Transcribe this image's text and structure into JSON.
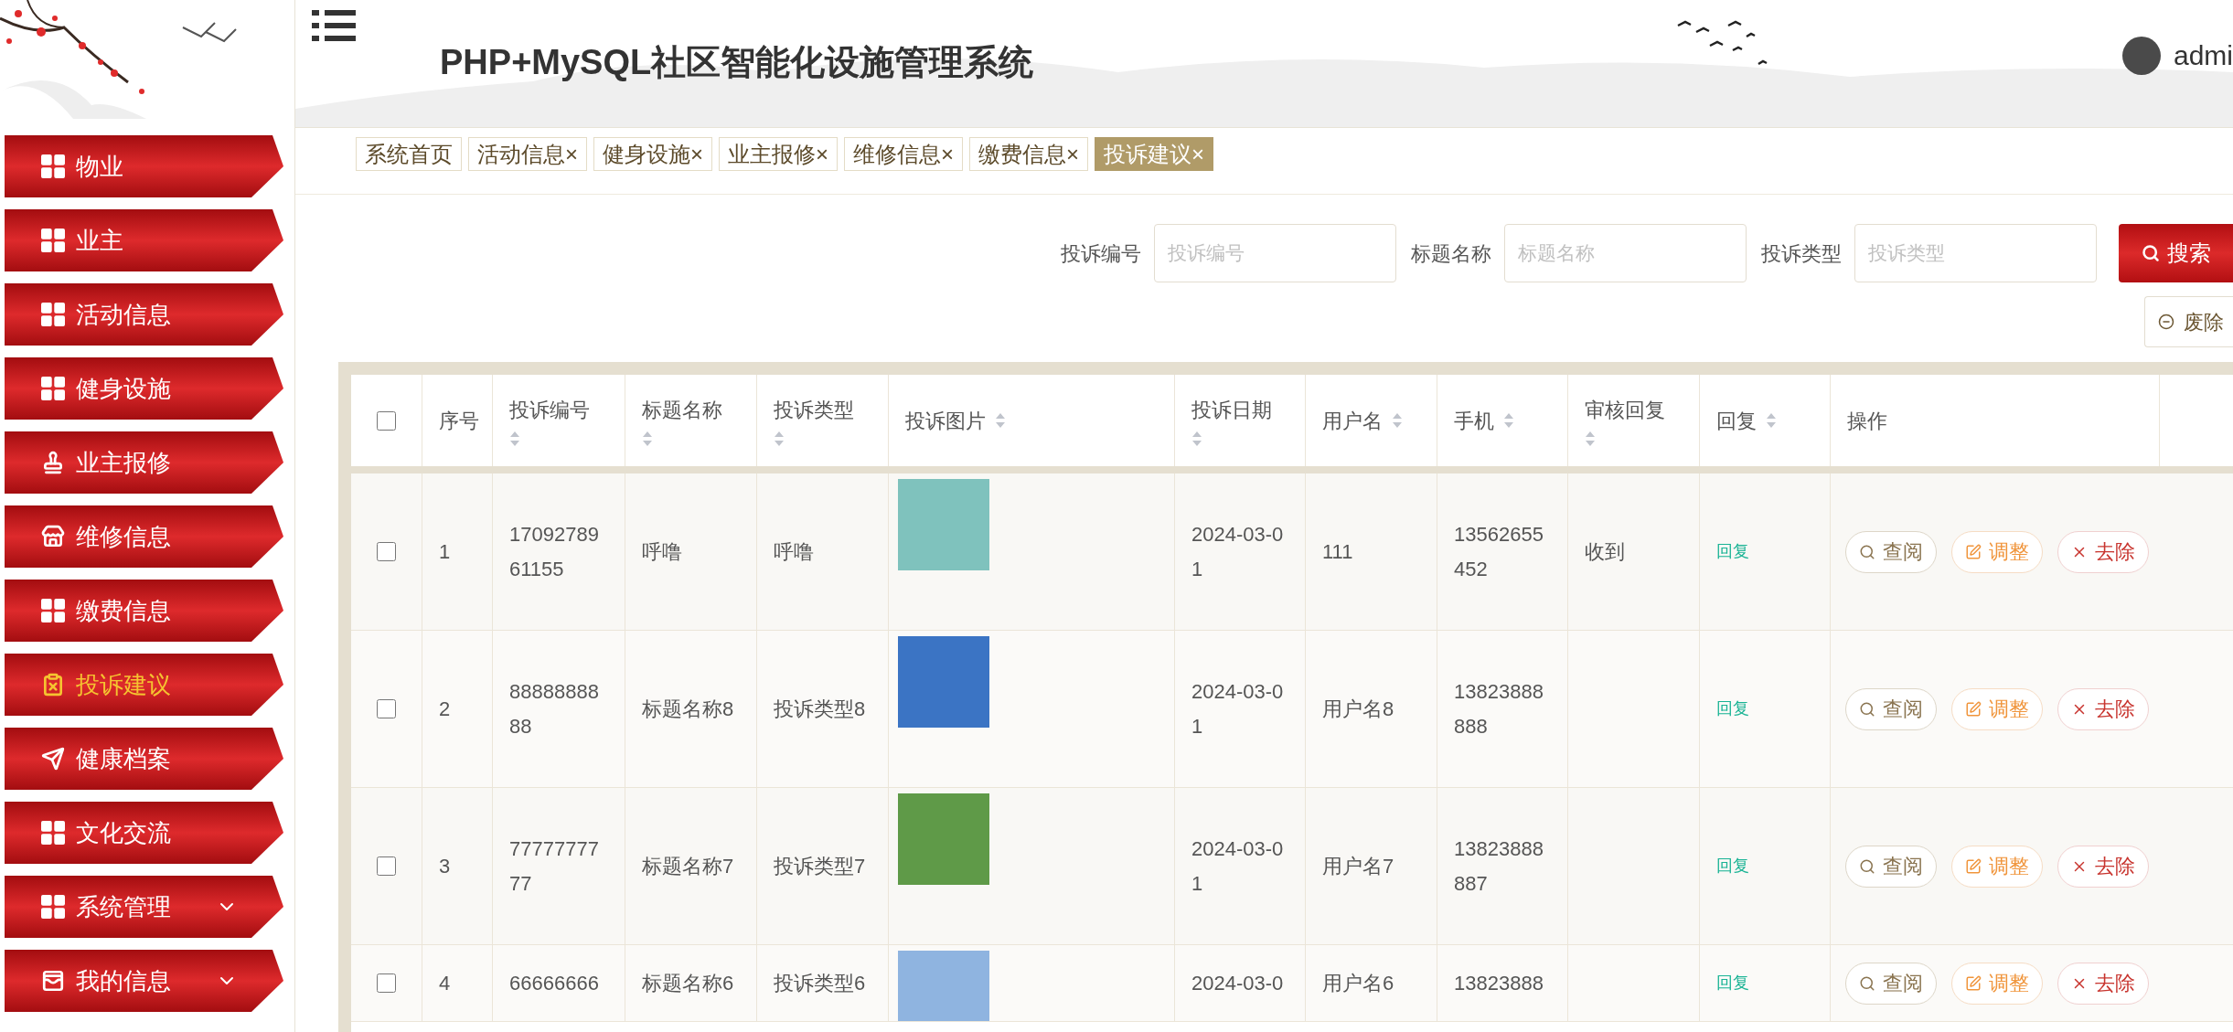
{
  "header": {
    "title": "PHP+MySQL社区智能化设施管理系统",
    "user": "admi"
  },
  "sidebar": {
    "items": [
      {
        "label": "物业",
        "kind": "link",
        "selected": false
      },
      {
        "label": "业主",
        "kind": "link",
        "selected": false
      },
      {
        "label": "活动信息",
        "kind": "link",
        "selected": false
      },
      {
        "label": "健身设施",
        "kind": "link",
        "selected": false
      },
      {
        "label": "业主报修",
        "kind": "link",
        "selected": false
      },
      {
        "label": "维修信息",
        "kind": "link",
        "selected": false
      },
      {
        "label": "缴费信息",
        "kind": "link",
        "selected": false
      },
      {
        "label": "投诉建议",
        "kind": "link",
        "selected": true
      },
      {
        "label": "健康档案",
        "kind": "link",
        "selected": false
      },
      {
        "label": "文化交流",
        "kind": "link",
        "selected": false
      },
      {
        "label": "系统管理",
        "kind": "group",
        "selected": false
      },
      {
        "label": "我的信息",
        "kind": "group",
        "selected": false
      }
    ]
  },
  "tabs": [
    {
      "label": "系统首页",
      "closable": false,
      "selected": false
    },
    {
      "label": "活动信息",
      "closable": true,
      "selected": false
    },
    {
      "label": "健身设施",
      "closable": true,
      "selected": false
    },
    {
      "label": "业主报修",
      "closable": true,
      "selected": false
    },
    {
      "label": "维修信息",
      "closable": true,
      "selected": false
    },
    {
      "label": "缴费信息",
      "closable": true,
      "selected": false
    },
    {
      "label": "投诉建议",
      "closable": true,
      "selected": true
    }
  ],
  "close_mark": "×",
  "search": {
    "fields": [
      {
        "label": "投诉编号",
        "placeholder": "投诉编号"
      },
      {
        "label": "标题名称",
        "placeholder": "标题名称"
      },
      {
        "label": "投诉类型",
        "placeholder": "投诉类型"
      }
    ],
    "button": "搜索",
    "delete_button": "废除"
  },
  "table": {
    "select_all_checked": false,
    "columns": [
      {
        "label": "序号",
        "sortable": false
      },
      {
        "label": "投诉编号",
        "sortable": true
      },
      {
        "label": "标题名称",
        "sortable": true
      },
      {
        "label": "投诉类型",
        "sortable": true
      },
      {
        "label": "投诉图片",
        "sortable": true
      },
      {
        "label": "投诉日期",
        "sortable": true
      },
      {
        "label": "用户名",
        "sortable": true
      },
      {
        "label": "手机",
        "sortable": true
      },
      {
        "label": "审核回复",
        "sortable": true
      },
      {
        "label": "回复",
        "sortable": true
      },
      {
        "label": "操作",
        "sortable": false
      }
    ],
    "rows": [
      {
        "checked": false,
        "index": "1",
        "number": "1709278961155",
        "title": "呼噜",
        "type": "呼噜",
        "date": "2024-03-01",
        "user": "111",
        "phone": "13562655452",
        "review": "收到",
        "reply": "回复",
        "actions": [
          {
            "label": "查阅",
            "kind": "view"
          },
          {
            "label": "调整",
            "kind": "edit"
          },
          {
            "label": "去除",
            "kind": "delete"
          }
        ]
      },
      {
        "checked": false,
        "index": "2",
        "number": "8888888888",
        "title": "标题名称8",
        "type": "投诉类型8",
        "date": "2024-03-01",
        "user": "用户名8",
        "phone": "13823888888",
        "reply": "回复",
        "actions": [
          {
            "label": "查阅",
            "kind": "view"
          },
          {
            "label": "调整",
            "kind": "edit"
          },
          {
            "label": "去除",
            "kind": "delete"
          }
        ]
      },
      {
        "checked": false,
        "index": "3",
        "number": "7777777777",
        "title": "标题名称7",
        "type": "投诉类型7",
        "date": "2024-03-01",
        "user": "用户名7",
        "phone": "13823888887",
        "reply": "回复",
        "actions": [
          {
            "label": "查阅",
            "kind": "view"
          },
          {
            "label": "调整",
            "kind": "edit"
          },
          {
            "label": "去除",
            "kind": "delete"
          }
        ]
      },
      {
        "checked": false,
        "index": "4",
        "number": "66666666",
        "title": "标题名称6",
        "type": "投诉类型6",
        "date": "2024-03-0",
        "user": "用户名6",
        "phone": "13823888",
        "reply": "回复",
        "actions": [
          {
            "label": "查阅",
            "kind": "view"
          },
          {
            "label": "调整",
            "kind": "edit"
          },
          {
            "label": "去除",
            "kind": "delete"
          }
        ]
      }
    ]
  }
}
